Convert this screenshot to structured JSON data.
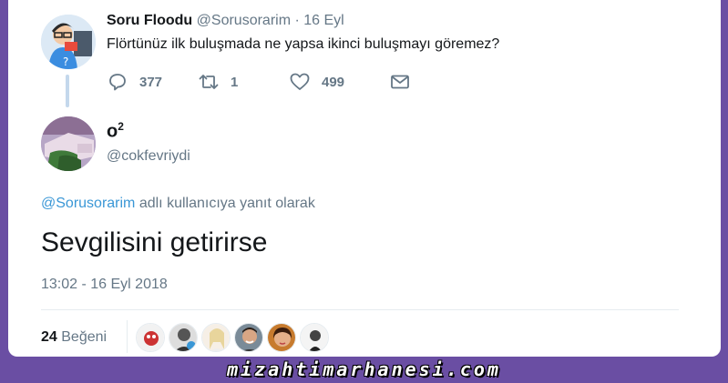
{
  "parent_tweet": {
    "name": "Soru Floodu",
    "handle": "@Sorusorarim",
    "date": "· 16 Eyl",
    "text": "Flörtünüz ilk buluşmada ne yapsa ikinci buluşmayı göremez?",
    "replies": "377",
    "retweets": "1",
    "likes": "499",
    "icons": [
      "reply-icon",
      "retweet-icon",
      "heart-icon",
      "mail-icon"
    ]
  },
  "main_tweet": {
    "name": "o",
    "name_sup": "2",
    "handle": "@cokfevriydi",
    "reply_mention": "@Sorusorarim",
    "reply_suffix": " adlı kullanıcıya yanıt olarak",
    "text": "Sevgilisini getirirse",
    "timestamp": "13:02 - 16 Eyl 2018",
    "like_count": "24",
    "like_label": " Beğeni"
  },
  "footer": {
    "watermark": "mizahtimarhanesi.com"
  },
  "colors": {
    "background": "#6a4ea3",
    "link": "#3a97d6",
    "muted": "#657786",
    "text": "#14171a"
  }
}
